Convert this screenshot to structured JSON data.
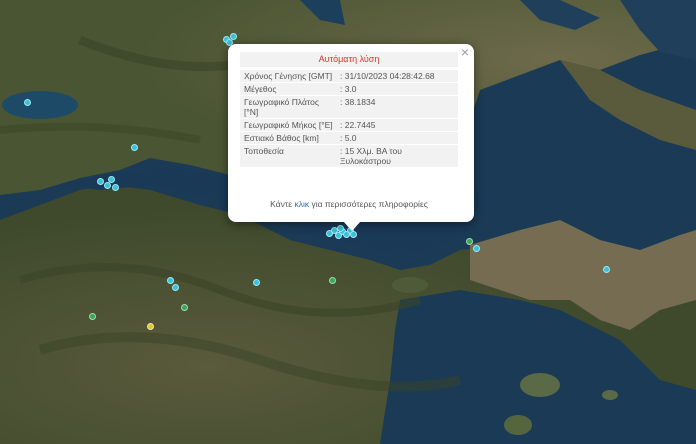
{
  "popup": {
    "title": "Αυτόματη λύση",
    "close_glyph": "×",
    "rows": [
      {
        "label": "Χρόνος Γένησης [GMT]",
        "value": ": 31/10/2023 04:28:42.68"
      },
      {
        "label": "Μέγεθος",
        "value": ": 3.0"
      },
      {
        "label": "Γεωγραφικό Πλάτος [°N]",
        "value": ": 38.1834"
      },
      {
        "label": "Γεωγραφικό Μήκος [°E]",
        "value": ": 22.7445"
      },
      {
        "label": "Εστιακό Βάθος [km]",
        "value": ": 5.0"
      },
      {
        "label": "Τοποθεσία",
        "value": ": 15 Χλμ. ΒΑ του Ξυλοκάστρου"
      }
    ],
    "more_prefix": "Κάντε",
    "more_link": "κλικ",
    "more_suffix": "για περισσότερες πληροφορίες"
  },
  "colors": {
    "sea": "#1b3a55",
    "land": "#4b5a36",
    "title_red": "#e0342c",
    "link_blue": "#2a6fb8",
    "marker_cyan": "#35c4dc",
    "marker_green": "#37a85a",
    "marker_yellow": "#e2c636"
  },
  "markers": [
    {
      "type": "cyan"
    },
    {
      "type": "cyan"
    },
    {
      "type": "cyan"
    },
    {
      "type": "cyan"
    },
    {
      "type": "cyan"
    },
    {
      "type": "cyan"
    },
    {
      "type": "cyan"
    },
    {
      "type": "cyan"
    },
    {
      "type": "cyan"
    },
    {
      "type": "cyan"
    },
    {
      "type": "cyan"
    },
    {
      "type": "cyan"
    },
    {
      "type": "cyan"
    },
    {
      "type": "cyan"
    },
    {
      "type": "cyan"
    },
    {
      "type": "green"
    },
    {
      "type": "green"
    },
    {
      "type": "green"
    },
    {
      "type": "green"
    },
    {
      "type": "yellow"
    }
  ]
}
